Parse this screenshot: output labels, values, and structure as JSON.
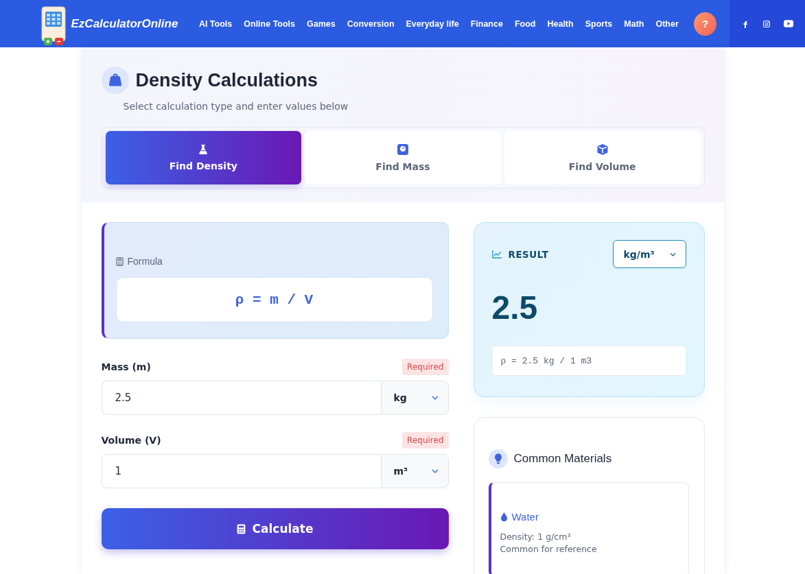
{
  "header": {
    "brand": "EzCalculatorOnline",
    "nav": [
      "AI Tools",
      "Online Tools",
      "Games",
      "Conversion",
      "Everyday life",
      "Finance",
      "Food",
      "Health",
      "Sports",
      "Math",
      "Other"
    ],
    "help": "?"
  },
  "calculator": {
    "title": "Density Calculations",
    "subtitle": "Select calculation type and enter values below",
    "tabs": [
      {
        "label": "Find Density",
        "selected": true
      },
      {
        "label": "Find Mass",
        "selected": false
      },
      {
        "label": "Find Volume",
        "selected": false
      }
    ],
    "formula": {
      "label": "Formula",
      "expression": "ρ = m / V"
    },
    "fields": [
      {
        "label": "Mass (m)",
        "badge": "Required",
        "value": "2.5",
        "unit": "kg"
      },
      {
        "label": "Volume (V)",
        "badge": "Required",
        "value": "1",
        "unit": "m³"
      }
    ],
    "calculate_button": "Calculate",
    "result": {
      "label": "RESULT",
      "unit": "kg/m³",
      "value": "2.5",
      "working": "ρ = 2.5 kg / 1 m3"
    },
    "materials": {
      "title": "Common Materials",
      "items": [
        {
          "name": "Water",
          "density": "Density: 1 g/cm³",
          "note": "Common for reference"
        }
      ]
    }
  }
}
